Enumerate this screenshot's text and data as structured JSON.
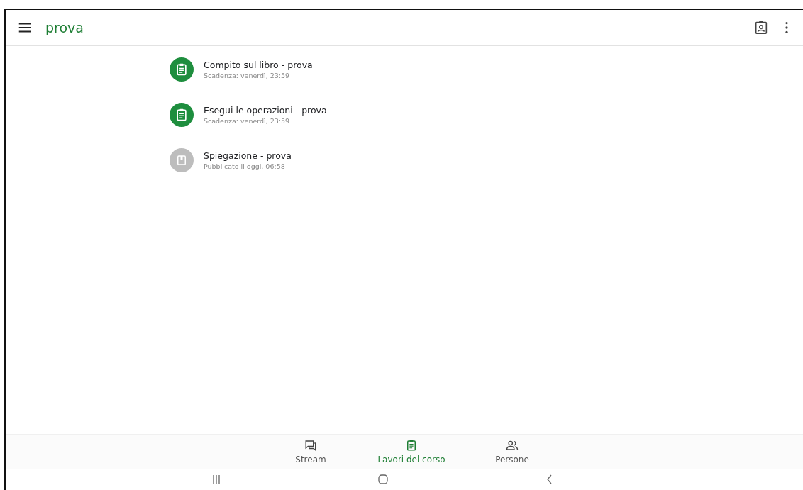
{
  "app_bar": {
    "title": "prova"
  },
  "items": [
    {
      "kind": "assignment",
      "title": "Compito sul libro - prova",
      "subtitle": "Scadenza: venerdì, 23:59"
    },
    {
      "kind": "assignment",
      "title": "Esegui le operazioni - prova",
      "subtitle": "Scadenza: venerdì, 23:59"
    },
    {
      "kind": "material",
      "title": "Spiegazione - prova",
      "subtitle": "Pubblicato il oggi, 06:58"
    }
  ],
  "bottom_nav": [
    {
      "kind": "stream",
      "label": "Stream",
      "selected": false
    },
    {
      "kind": "classwork",
      "label": "Lavori del corso",
      "selected": true
    },
    {
      "kind": "people",
      "label": "Persone",
      "selected": false
    }
  ]
}
